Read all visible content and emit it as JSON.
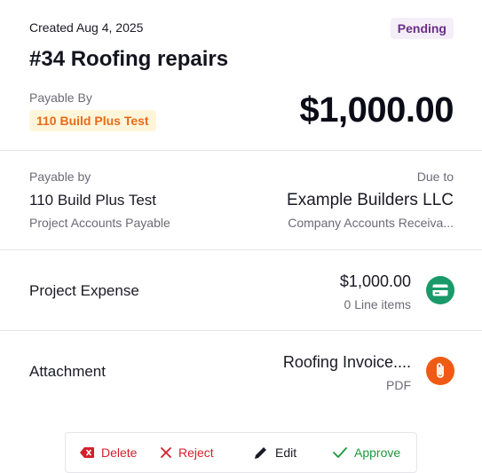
{
  "header": {
    "created": "Created Aug 4, 2025",
    "status": "Pending",
    "title": "#34 Roofing repairs",
    "payable_by_label": "Payable By",
    "payable_by_tag": "110 Build Plus Test",
    "amount": "$1,000.00"
  },
  "parties": {
    "from_label": "Payable by",
    "from_name": "110 Build Plus Test",
    "from_account": "Project Accounts Payable",
    "to_label": "Due to",
    "to_name": "Example Builders LLC",
    "to_account": "Company Accounts Receiva..."
  },
  "expense": {
    "label": "Project Expense",
    "amount": "$1,000.00",
    "sub": "0 Line items",
    "icon": "card-icon",
    "icon_color": "#1a9a6a"
  },
  "attachment": {
    "label": "Attachment",
    "file_name": "Roofing Invoice....",
    "file_type": "PDF",
    "icon": "paperclip-icon",
    "icon_color": "#f05a14"
  },
  "actions": {
    "delete": "Delete",
    "reject": "Reject",
    "edit": "Edit",
    "approve": "Approve"
  },
  "colors": {
    "danger": "#d4202c",
    "success": "#1a9a3a",
    "pending_bg": "#f4eef9",
    "pending_fg": "#6a2f86",
    "tag_bg": "#fff5d9",
    "tag_fg": "#e86a1a"
  }
}
